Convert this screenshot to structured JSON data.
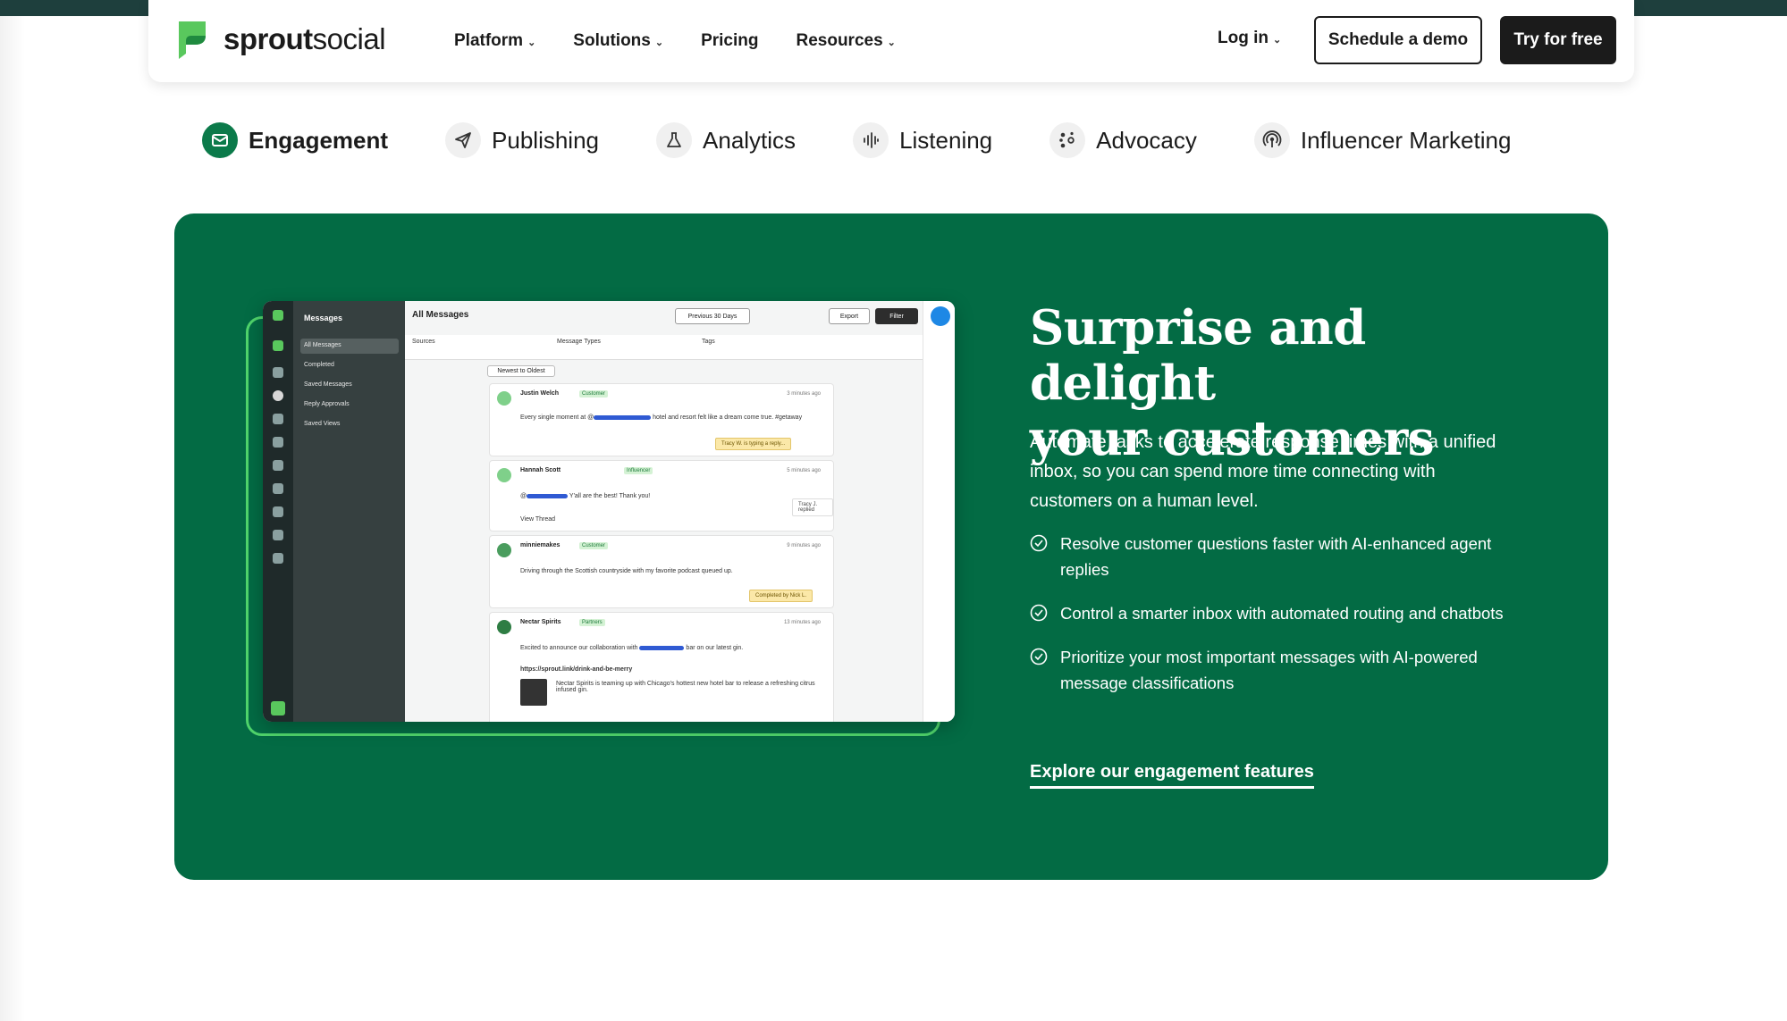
{
  "brand": {
    "name_part1": "sprout",
    "name_part2": "social",
    "accent": "#59c85d",
    "dark_green": "#036b44"
  },
  "nav": {
    "links": [
      {
        "label": "Platform",
        "has_dropdown": true
      },
      {
        "label": "Solutions",
        "has_dropdown": true
      },
      {
        "label": "Pricing",
        "has_dropdown": false
      },
      {
        "label": "Resources",
        "has_dropdown": true
      }
    ],
    "login_label": "Log in",
    "demo_label": "Schedule a demo",
    "try_label": "Try for free"
  },
  "tabs": [
    {
      "label": "Engagement",
      "icon": "mail-icon",
      "active": true
    },
    {
      "label": "Publishing",
      "icon": "send-icon",
      "active": false
    },
    {
      "label": "Analytics",
      "icon": "flask-icon",
      "active": false
    },
    {
      "label": "Listening",
      "icon": "waveform-icon",
      "active": false
    },
    {
      "label": "Advocacy",
      "icon": "nodes-icon",
      "active": false
    },
    {
      "label": "Influencer Marketing",
      "icon": "broadcast-icon",
      "active": false
    }
  ],
  "hero": {
    "title_line1": "Surprise and delight",
    "title_line2": "your customers",
    "subtitle": "Automate tasks to accelerate response times with a unified inbox, so you can spend more time connecting with customers on a human level.",
    "bullets": [
      "Resolve customer questions faster with AI-enhanced agent replies",
      "Control a smarter inbox with automated routing and chatbots",
      "Prioritize your most important messages with AI-powered message classifications"
    ],
    "cta": "Explore our engagement features"
  },
  "app_preview": {
    "sidebar_title": "Messages",
    "sidebar_items": [
      "All Messages",
      "Completed",
      "Saved Messages",
      "Reply Approvals",
      "Saved Views"
    ],
    "main_title": "All Messages",
    "toolbar": [
      "Previous 30 Days",
      "Export",
      "Filter"
    ],
    "filters": [
      "Sources",
      "Message Types",
      "Tags"
    ],
    "sort_label": "Newest to Oldest",
    "messages": [
      {
        "name": "Justin Welch",
        "tag": "Customer",
        "time": "3 minutes ago",
        "text_before": "Every single moment at @",
        "text_after": " hotel and resort felt like a dream come true. #getaway",
        "note": "Tracy W. is typing a reply..."
      },
      {
        "name": "Hannah Scott",
        "tag": "Influencer",
        "time": "5 minutes ago",
        "text_before": "@",
        "text_after": " Y'all are the best! Thank you!",
        "note": "Tracy J. replied",
        "extra": "View Thread"
      },
      {
        "name": "minniemakes",
        "tag": "Customer",
        "time": "9 minutes ago",
        "text_before": "Driving through the Scottish countryside with my favorite podcast queued up.",
        "text_after": "",
        "note": "Completed by Nick L."
      },
      {
        "name": "Nectar Spirits",
        "tag": "Partners",
        "time": "13 minutes ago",
        "text_before": "Excited to announce our collaboration with ",
        "text_after": " bar on our latest gin.",
        "link": "https://sprout.link/drink-and-be-merry",
        "link_text": "Nectar Spirits is teaming up with Chicago's hottest new hotel bar to release a refreshing citrus infused gin."
      }
    ]
  }
}
